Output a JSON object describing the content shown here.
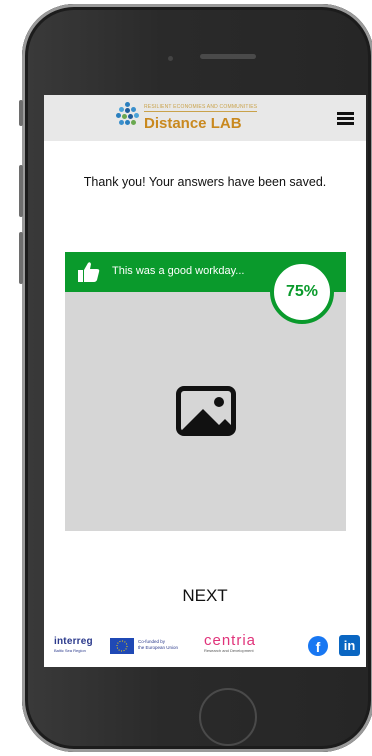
{
  "header": {
    "tagline": "RESILIENT ECONOMIES AND COMMUNITIES",
    "title": "Distance LAB",
    "menu_icon": "hamburger-menu-icon"
  },
  "main": {
    "confirmation": "Thank you! Your answers have been saved.",
    "result": {
      "banner_text": "This was a good workday...",
      "score": "75%",
      "icon": "thumbs-up-icon",
      "image_icon": "image-placeholder-icon"
    },
    "next_label": "NEXT"
  },
  "footer": {
    "interreg": "interreg",
    "interreg_region": "Baltic Sea Region",
    "eu_line1": "Co-funded by",
    "eu_line2": "the European Union",
    "centria": "centria",
    "centria_sub": "Research and Development",
    "facebook_letter": "f",
    "linkedin_letters": "in"
  },
  "colors": {
    "accent_green": "#0a9a2c",
    "brand_gold": "#c9891f",
    "header_bg": "#e8e8e8",
    "card_bg": "#d6d6d6"
  }
}
